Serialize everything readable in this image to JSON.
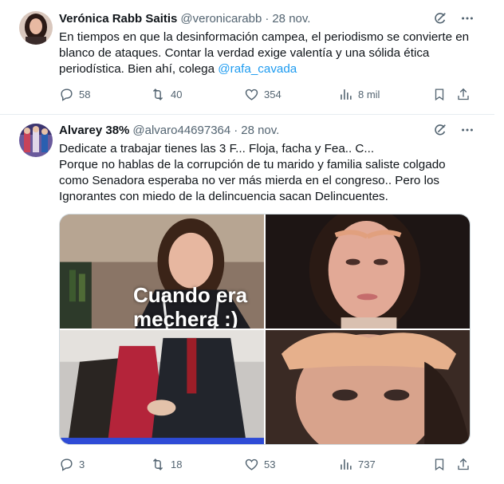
{
  "tweets": [
    {
      "author_name": "Verónica Rabb Saitis",
      "handle": "@veronicarabb",
      "separator": "·",
      "date": "28 nov.",
      "text_before": "En tiempos en que la desinformación campea,  el periodismo se convierte en blanco de ataques. Contar la verdad exige valentía y una sólida ética periodística. Bien ahí, colega ",
      "mention": "@rafa_cavada",
      "replies": "58",
      "reposts": "40",
      "likes": "354",
      "views": "8 mil"
    },
    {
      "author_name": "Alvarey 38%",
      "handle": "@alvaro44697364",
      "separator": "·",
      "date": "28 nov.",
      "text_lines": [
        "Dedicate a trabajar tienes las 3 F... Floja, facha y Fea.. C...",
        "Porque no hablas de la corrupción de tu marido y familia saliste colgado como Senadora esperaba no ver más mierda en el congreso.. Pero los Ignorantes con miedo de la delincuencia sacan Delincuentes."
      ],
      "image_caption": "Cuando era mechera :)",
      "replies": "3",
      "reposts": "18",
      "likes": "53",
      "views": "737"
    }
  ],
  "icons": {
    "grok": "grok-icon",
    "more": "more-icon",
    "reply": "reply-icon",
    "repost": "repost-icon",
    "like": "like-icon",
    "views": "views-icon",
    "bookmark": "bookmark-icon",
    "share": "share-icon"
  },
  "colors": {
    "text": "#0f1419",
    "secondary": "#536471",
    "link": "#1d9bf0",
    "divider": "#e6ecf0"
  }
}
